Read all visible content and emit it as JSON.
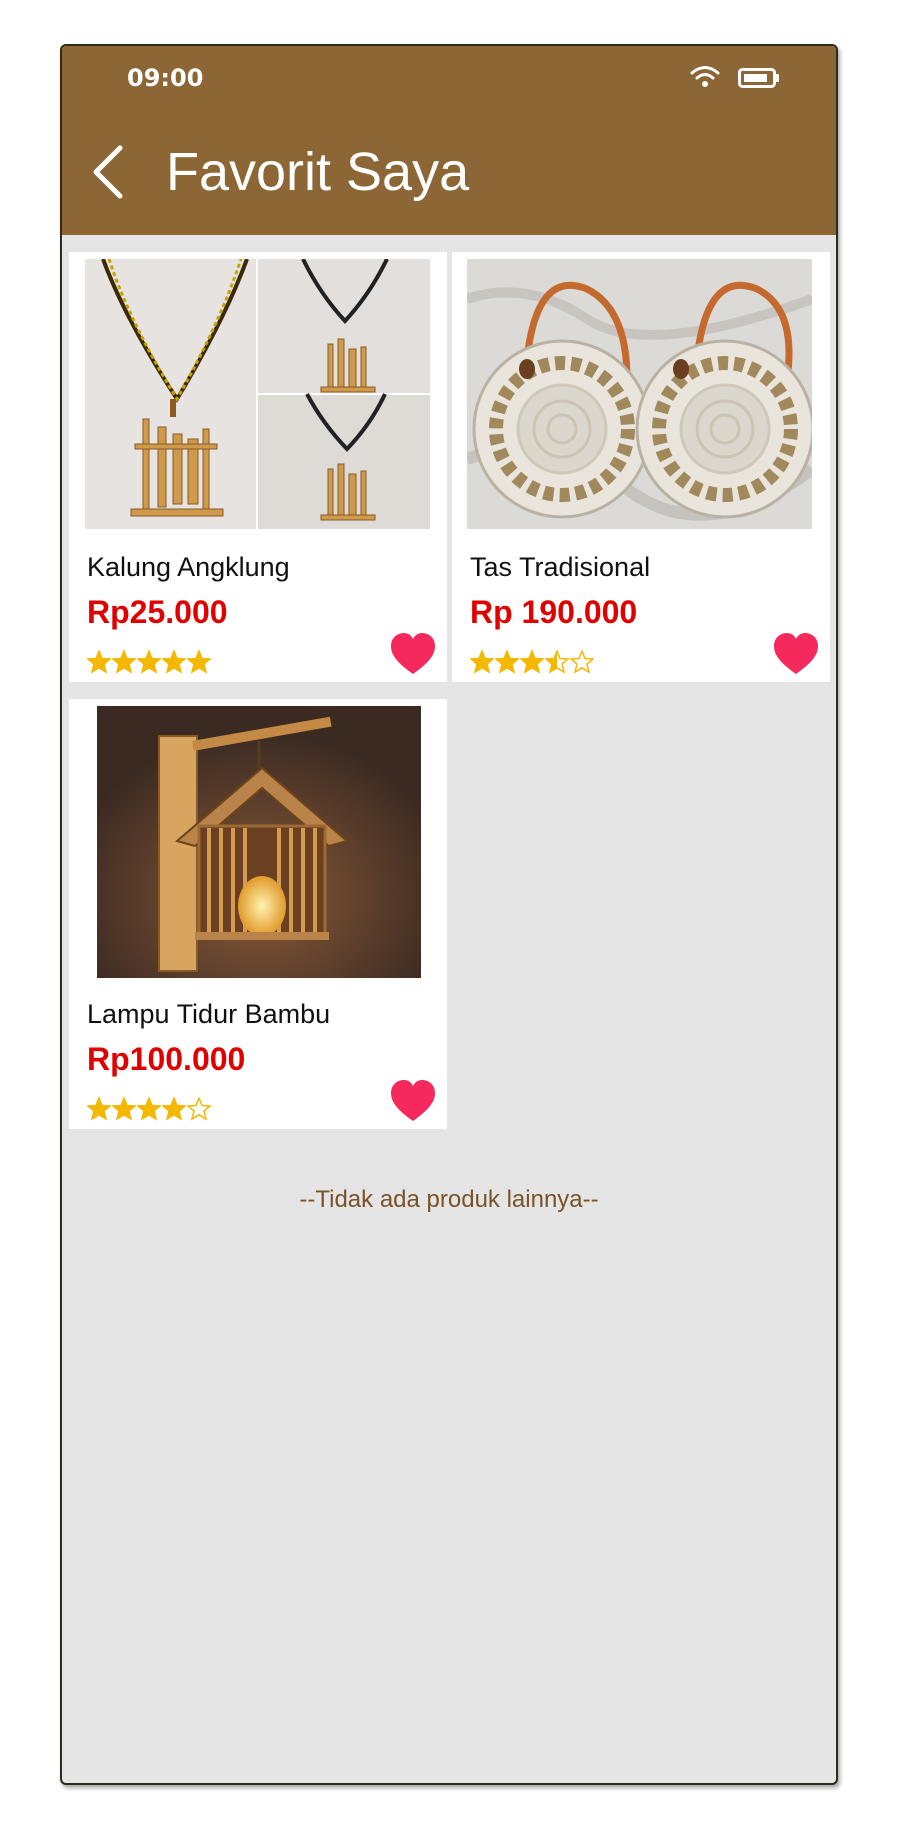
{
  "status_bar": {
    "time": "09:00",
    "wifi_icon": "wifi-icon",
    "battery_icon": "battery-icon"
  },
  "header": {
    "title": "Favorit Saya",
    "back_icon": "chevron-left-icon"
  },
  "colors": {
    "app_bar": "#8c6735",
    "price": "#e00000",
    "heart": "#f5295c",
    "star": "#f5b800",
    "footer_text": "#7a5228"
  },
  "products": [
    {
      "name": "Kalung Angklung",
      "price": "Rp25.000",
      "rating": 5,
      "favorite": true
    },
    {
      "name": "Tas Tradisional",
      "price": "Rp 190.000",
      "rating": 3.5,
      "favorite": true
    },
    {
      "name": "Lampu Tidur Bambu",
      "price": "Rp100.000",
      "rating": 4,
      "favorite": true
    }
  ],
  "footer": {
    "no_more_text": "--Tidak ada produk lainnya--"
  }
}
